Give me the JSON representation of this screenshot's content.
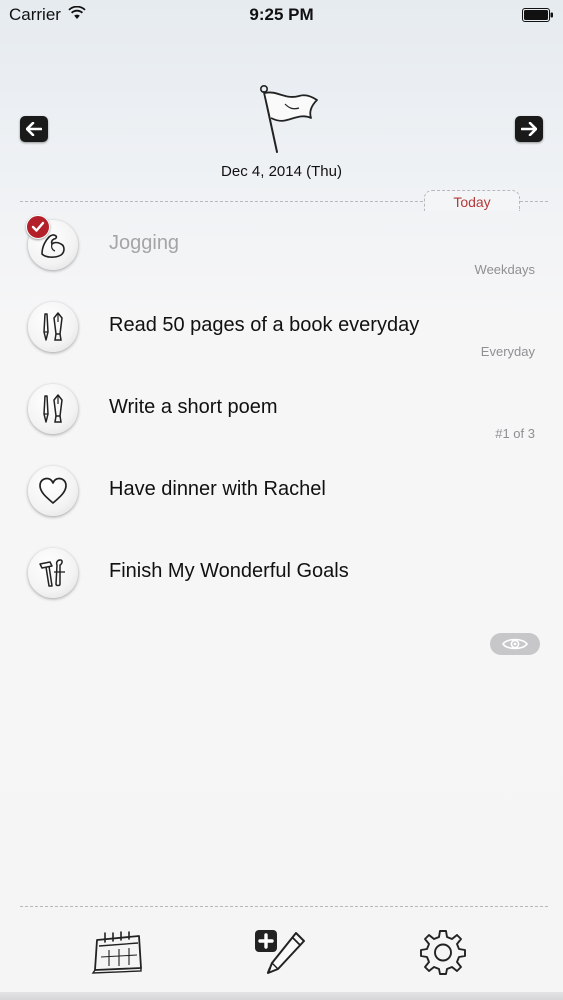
{
  "status_bar": {
    "carrier": "Carrier",
    "time": "9:25 PM"
  },
  "header": {
    "date": "Dec 4, 2014 (Thu)",
    "today_tab": "Today",
    "icons": {
      "prev": "arrow-left-icon",
      "next": "arrow-right-icon",
      "flag": "flag-icon"
    }
  },
  "tasks": [
    {
      "title": "Jogging",
      "meta": "Weekdays",
      "completed": true,
      "icon": "muscle-arm-icon"
    },
    {
      "title": "Read 50 pages of a book everyday",
      "meta": "Everyday",
      "completed": false,
      "icon": "pen-brush-icon"
    },
    {
      "title": "Write a short poem",
      "meta": "#1 of 3",
      "completed": false,
      "icon": "pen-brush-icon"
    },
    {
      "title": "Have dinner with Rachel",
      "meta": "",
      "completed": false,
      "icon": "heart-icon"
    },
    {
      "title": "Finish My Wonderful Goals",
      "meta": "",
      "completed": false,
      "icon": "tools-icon"
    }
  ],
  "toolbar": {
    "calendar": "calendar-icon",
    "add": "add-pencil-icon",
    "settings": "gear-icon"
  },
  "colors": {
    "accent_red": "#b3202a",
    "today_text": "#b33a3a",
    "nav_button": "#1a1a1a"
  }
}
